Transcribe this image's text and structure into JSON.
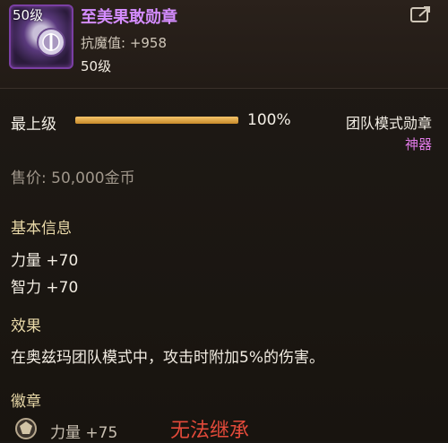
{
  "item": {
    "level_badge": "50级",
    "name": "至美果敢勋章",
    "stat_line": "抗魔值: +958",
    "level": "50级"
  },
  "progress": {
    "label": "最上级",
    "percent_text": "100%",
    "fill_fraction": 1.0
  },
  "mode": {
    "label": "团队模式勋章",
    "rarity": "神器"
  },
  "price": "售价: 50,000金币",
  "basic_info": {
    "title": "基本信息",
    "attrs": [
      "力量 +70",
      "智力 +70"
    ]
  },
  "effect": {
    "title": "效果",
    "text": "在奥兹玛团队模式中，攻击时附加5%的伤害。"
  },
  "badge": {
    "title": "徽章",
    "stat": "力量 +75",
    "icon": "badge-slot-icon"
  },
  "overlay_note": "无法继承",
  "colors": {
    "item_name": "#d48cff",
    "rarity": "#e07ae6",
    "section_title": "#e9d9a8",
    "bar_fill": "#e0a94a",
    "warning": "#e34a3a"
  },
  "icons": [
    "medal-icon",
    "share-icon",
    "badge-slot-icon"
  ]
}
